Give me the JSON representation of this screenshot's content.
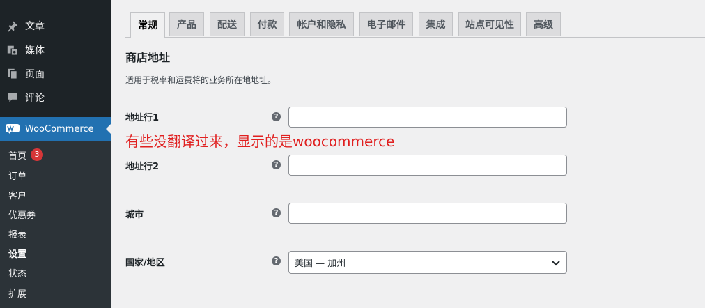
{
  "sidebar": {
    "menu": [
      {
        "label": "文章",
        "icon": "pushpin-icon"
      },
      {
        "label": "媒体",
        "icon": "media-icon"
      },
      {
        "label": "页面",
        "icon": "pages-icon"
      },
      {
        "label": "评论",
        "icon": "comment-icon"
      }
    ],
    "woocommerce": {
      "label": "WooCommerce",
      "icon": "woo-logo-icon"
    },
    "submenu": [
      {
        "label": "首页",
        "badge": "3"
      },
      {
        "label": "订单"
      },
      {
        "label": "客户"
      },
      {
        "label": "优惠券"
      },
      {
        "label": "报表"
      },
      {
        "label": "设置",
        "current": true
      },
      {
        "label": "状态"
      },
      {
        "label": "扩展"
      }
    ]
  },
  "tabs": [
    {
      "label": "常规",
      "active": true
    },
    {
      "label": "产品"
    },
    {
      "label": "配送"
    },
    {
      "label": "付款"
    },
    {
      "label": "帐户和隐私"
    },
    {
      "label": "电子邮件"
    },
    {
      "label": "集成"
    },
    {
      "label": "站点可见性"
    },
    {
      "label": "高级"
    }
  ],
  "section": {
    "title": "商店地址",
    "description": "适用于税率和运费将的业务所在地地址。"
  },
  "fields": {
    "address1": {
      "label": "地址行1",
      "value": ""
    },
    "address2": {
      "label": "地址行2",
      "value": ""
    },
    "city": {
      "label": "城市",
      "value": ""
    },
    "country": {
      "label": "国家/地区",
      "value": "美国 — 加州"
    }
  },
  "help_glyph": "?",
  "annotation": "有些没翻译过来，显示的是woocommerce",
  "colors": {
    "sidebar_bg": "#1d2327",
    "submenu_bg": "#2c3338",
    "accent": "#2271b1",
    "badge": "#d63638",
    "annotation": "#e02020"
  }
}
